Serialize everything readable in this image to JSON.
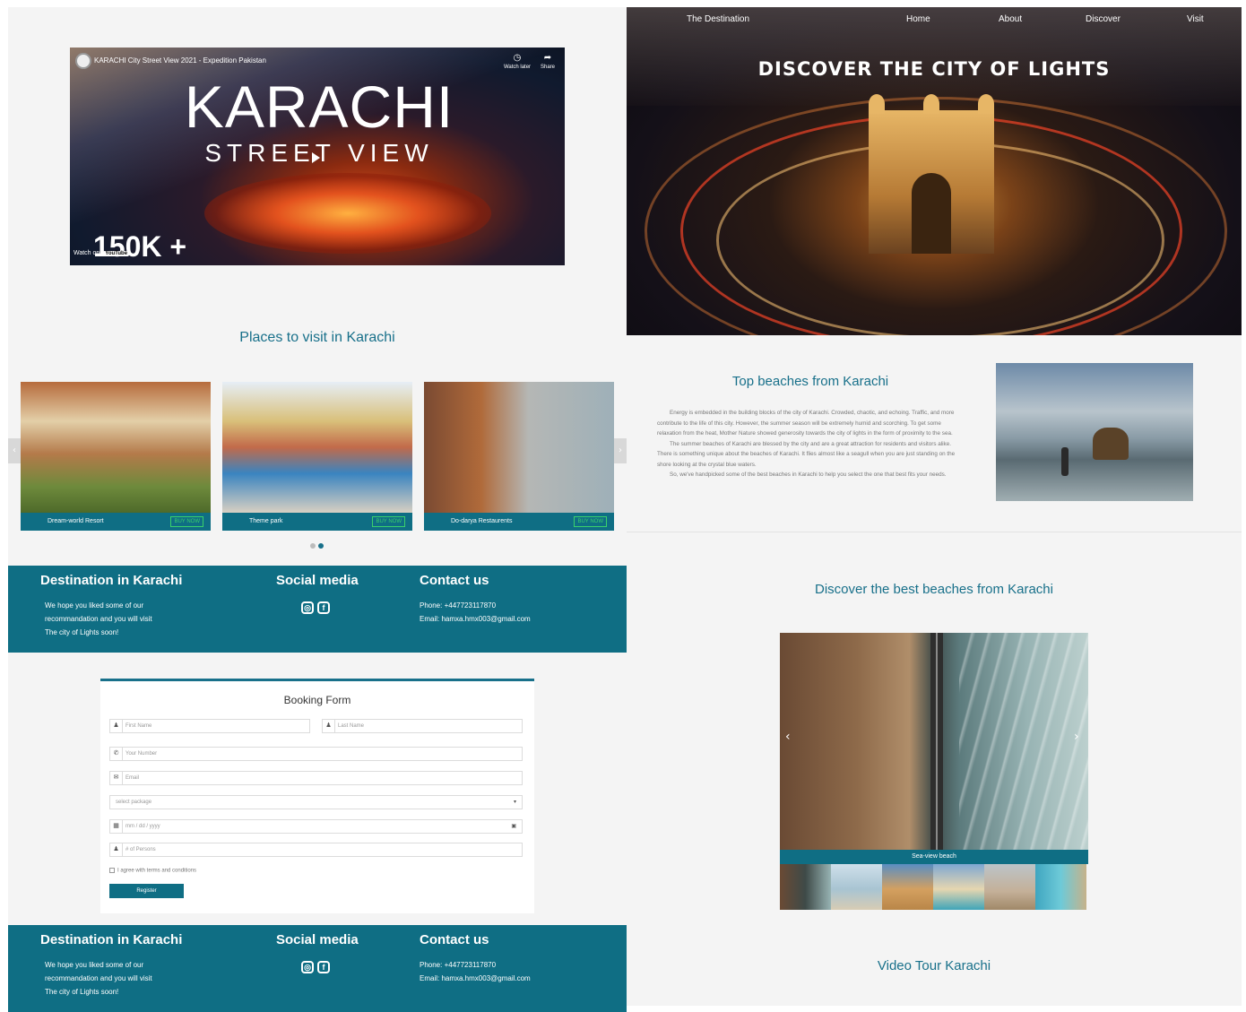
{
  "video": {
    "title": "KARACHI City Street View 2021 - Expedition Pakistan",
    "watch_later": "Watch later",
    "share": "Share",
    "overlay_big": "KARACHI",
    "overlay_sub": "STREET VIEW",
    "views_overlay": "150K +",
    "watch_on": "Watch on",
    "youtube": "YouTube"
  },
  "places": {
    "title": "Places to visit in Karachi",
    "cards": [
      {
        "name": "Dream-world Resort",
        "button": "BUY NOW"
      },
      {
        "name": "Theme park",
        "button": "BUY NOW"
      },
      {
        "name": "Do-darya Restaurents",
        "button": "BUY NOW"
      }
    ],
    "prev": "‹",
    "next": "›",
    "active_slide": 2,
    "slides": 2
  },
  "footer": {
    "col1_title": "Destination in Karachi",
    "col1_lines": [
      "We hope you liked some of our",
      "recommandation and you will visit",
      "The city of Lights soon!"
    ],
    "col2_title": "Social media",
    "col3_title": "Contact us",
    "phone": "Phone: +447723117870",
    "email": "Email: hamxa.hmx003@gmail.com",
    "social_icons": [
      "instagram-icon",
      "facebook-icon"
    ]
  },
  "booking": {
    "title": "Booking Form",
    "first_name": "First Name",
    "last_name": "Last Name",
    "phone": "Your Number",
    "email": "Email",
    "package": "select package",
    "date": "mm / dd / yyyy",
    "persons": "# of Persons",
    "agree": "I agree with terms and conditions",
    "submit": "Register"
  },
  "nav": {
    "brand": "The Destination",
    "items": [
      "Home",
      "About",
      "Discover",
      "Visit"
    ]
  },
  "hero": {
    "heading": "DISCOVER THE CITY OF LIGHTS"
  },
  "beaches": {
    "title": "Top beaches from Karachi",
    "paragraphs": [
      "Energy is embedded in the building blocks of the city of Karachi. Crowded, chaotic, and echoing. Traffic, and more contribute to the life of this city. However, the summer season will be extremely humid and scorching. To get some relaxation from the heat, Mother Nature showed generosity towards the city of lights in the form of proximity to the sea.",
      "The summer beaches of Karachi are blessed by the city and are a great attraction for residents and visitors alike. There is something unique about the beaches of Karachi. It flies almost like a seagull when you are just standing on the shore looking at the crystal blue waters.",
      "So, we've handpicked some of the best beaches in Karachi to help you select the one that best fits your needs."
    ]
  },
  "discover": {
    "title": "Discover the best beaches from Karachi",
    "caption": "Sea-view beach",
    "prev": "‹",
    "next": "›"
  },
  "video_tour": {
    "title": "Video Tour Karachi"
  },
  "colors": {
    "primary": "#0f6e84",
    "heading": "#18708a",
    "buy_now": "#3ad16b",
    "background": "#f4f4f4"
  }
}
